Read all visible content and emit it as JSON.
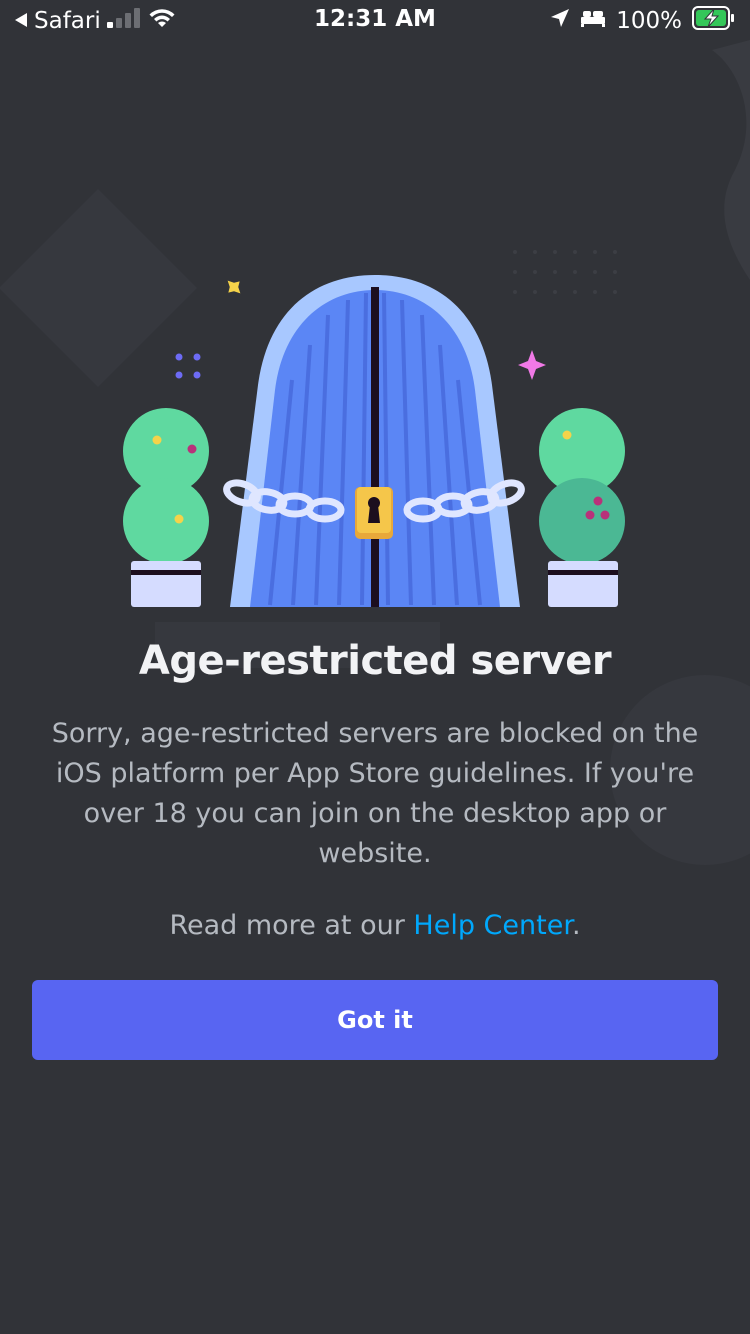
{
  "status_bar": {
    "back_app": "Safari",
    "time": "12:31 AM",
    "battery_percent": "100%",
    "signal_bars_filled": 1,
    "signal_bars_total": 4
  },
  "icons": {
    "back": "back-arrow-icon",
    "signal": "cellular-signal-icon",
    "wifi": "wifi-icon",
    "location": "location-arrow-icon",
    "sleep": "bed-icon",
    "battery": "battery-charging-icon",
    "illustration": "locked-gate-illustration"
  },
  "modal": {
    "title": "Age-restricted server",
    "description": "Sorry, age-restricted servers are blocked on the iOS platform per App Store guidelines. If you're over 18 you can join on the desktop app or website.",
    "read_more_prefix": "Read more at our ",
    "help_link": "Help Center",
    "read_more_suffix": ".",
    "button_label": "Got it"
  },
  "colors": {
    "background": "#313338",
    "accent": "#5865f2",
    "link": "#00a8fc",
    "battery": "#34c759",
    "gate": "#5b86f5",
    "shrub": "#5fd9a0"
  }
}
